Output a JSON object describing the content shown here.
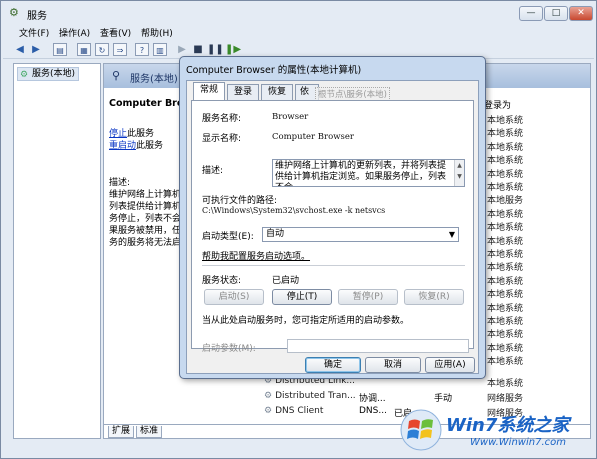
{
  "window": {
    "title": "服务",
    "controls": {
      "minimize": "—",
      "maximize": "□",
      "close": "✕"
    }
  },
  "menubar": [
    "文件(F)",
    "操作(A)",
    "查看(V)",
    "帮助(H)"
  ],
  "tree": {
    "root": "服务(本地)"
  },
  "pane": {
    "header": "服务(本地)",
    "selected_service": "Computer Brow",
    "stop_link": "停止",
    "stop_suffix": "此服务",
    "restart_link": "重启动",
    "restart_suffix": "此服务",
    "desc_heading": "描述:",
    "desc_lines": [
      "维护网络上计算机",
      "列表提供给计算机",
      "务停止，列表不会",
      "果服务被禁用，任",
      "务的服务将无法启"
    ],
    "startup_header": "登录为",
    "right_column": [
      "本地系统",
      "本地系统",
      "本地系统",
      "本地系统",
      "本地系统",
      "本地系统",
      "本地服务",
      "本地系统",
      "本地系统",
      "本地系统",
      "本地系统",
      "本地系统",
      "本地系统",
      "本地系统",
      "本地系统",
      "本地系统",
      "本地系统",
      "本地系统",
      "本地系统"
    ],
    "rows": [
      {
        "name": "Distributed Link...",
        "status": "",
        "startup": "",
        "logon": "本地系统"
      },
      {
        "name": "Distributed Tran...",
        "status": "协调...",
        "startup": "手动",
        "logon": "网络服务"
      },
      {
        "name": "DNS Client",
        "status": "DNS...",
        "startup": "已启",
        "logon": "网络服务"
      }
    ],
    "bottom_tabs": [
      "扩展",
      "标准"
    ]
  },
  "dialog": {
    "title": "Computer Browser 的属性(本地计算机)",
    "tabs": [
      "常规",
      "登录",
      "恢复",
      "依存关系"
    ],
    "ghost_text": "根节点\\服务(本地)",
    "fields": {
      "service_name_label": "服务名称:",
      "service_name_value": "Browser",
      "display_name_label": "显示名称:",
      "display_name_value": "Computer Browser",
      "description_label": "描述:",
      "description_value": "维护网络上计算机的更新列表，并将列表提供给计算机指定浏览。如果服务停止，列表不会",
      "path_label": "可执行文件的路径:",
      "path_value": "C:\\Windows\\System32\\svchost.exe -k netsvcs",
      "startup_type_label": "启动类型(E):",
      "startup_type_value": "自动",
      "help_link": "帮助我配置服务启动选项。",
      "status_label": "服务状态:",
      "status_value": "已启动"
    },
    "control_buttons": {
      "start": "启动(S)",
      "stop": "停止(T)",
      "pause": "暂停(P)",
      "resume": "恢复(R)"
    },
    "start_params_note": "当从此处启动服务时，您可指定所适用的启动参数。",
    "start_params_label": "启动参数(M):",
    "footer": {
      "ok": "确定",
      "cancel": "取消",
      "apply": "应用(A)"
    }
  },
  "watermark": {
    "brand": "Win7系统之家",
    "url": "Www.Winwin7.com"
  },
  "colors": {
    "accent": "#1a63c5",
    "link": "#0a36c4",
    "header": "#a7bfdd"
  }
}
